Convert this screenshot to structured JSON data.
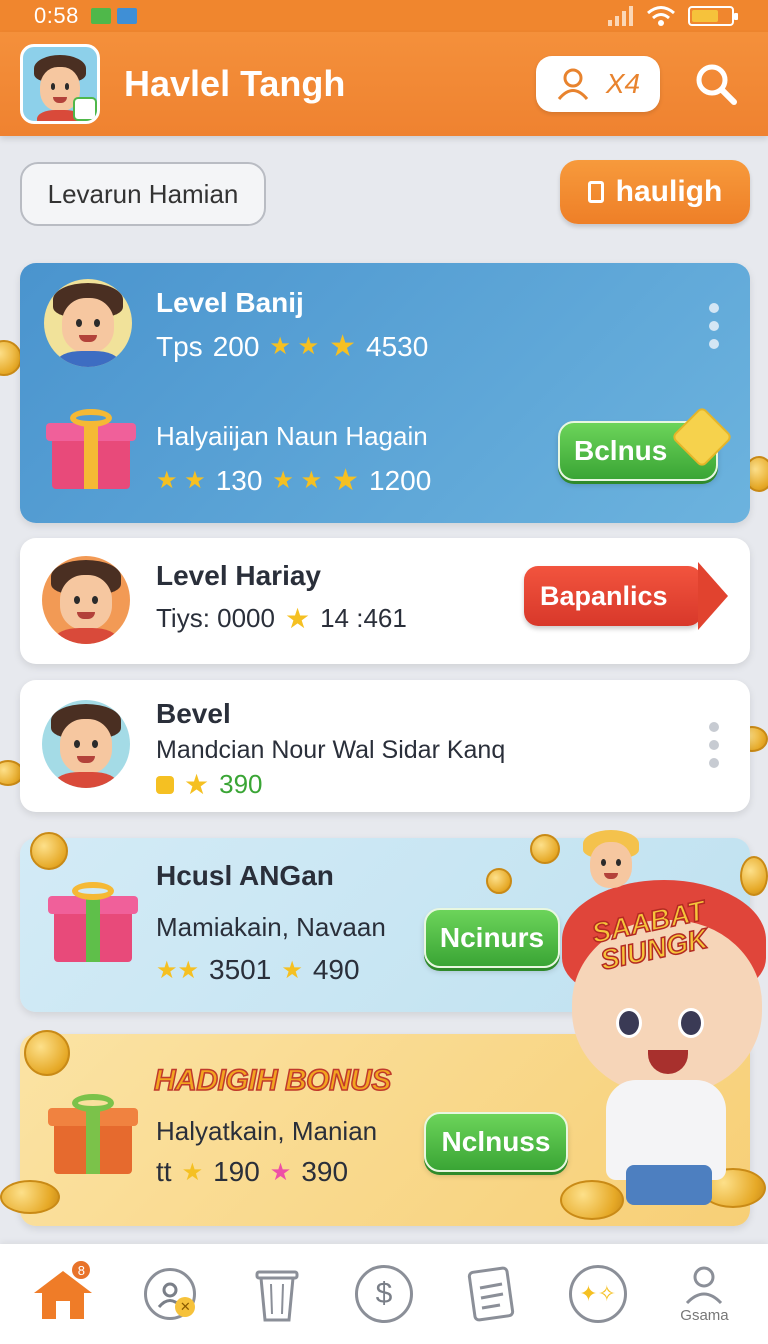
{
  "statusbar": {
    "time": "0:58"
  },
  "header": {
    "title": "Havlel Tangh",
    "user_pill_text": "X4"
  },
  "chips": {
    "left": "Levarun Hamian",
    "right": "hauligh"
  },
  "card_blue": {
    "row1_title": "Level Banij",
    "row1_prefix": "Tps",
    "row1_val1": "200",
    "row1_val2": "4530",
    "row2_title": "Halyaiijan Naun Hagain",
    "row2_val1": "130",
    "row2_val2": "1200",
    "button": "Bclnus"
  },
  "card_white1": {
    "title": "Level Hariay",
    "prefix": "Tiys: 0000",
    "value": "14 :461",
    "button": "Bapanlics"
  },
  "card_white2": {
    "title": "Bevel",
    "subtitle": "Mandcian Nour Wal Sidar Kanq",
    "value": "390"
  },
  "card_lightblue": {
    "title": "Hcusl ANGan",
    "subtitle": "Mamiakain, Navaan",
    "val1": "3501",
    "val2": "490",
    "button": "Ncinurs"
  },
  "card_yellow": {
    "title": "HADIGIH BONUS",
    "subtitle": "Halyatkain, Manian",
    "prefix": "tt",
    "val1": "190",
    "val2": "390",
    "button": "Nclnuss"
  },
  "mascot_badge": {
    "line1": "SAABAT",
    "line2": "SIUNGK"
  },
  "nav": {
    "last_label": "Gsama",
    "home_badge": "8"
  },
  "colors": {
    "primary": "#f0862e",
    "green": "#3aa535",
    "blue_card": "#4a94ce"
  },
  "icons": [
    "signal-icon",
    "wifi-icon",
    "battery-icon",
    "user-icon",
    "search-icon",
    "home-icon",
    "profile-icon",
    "trash-icon",
    "dollar-icon",
    "document-icon",
    "magic-icon",
    "person-icon"
  ]
}
